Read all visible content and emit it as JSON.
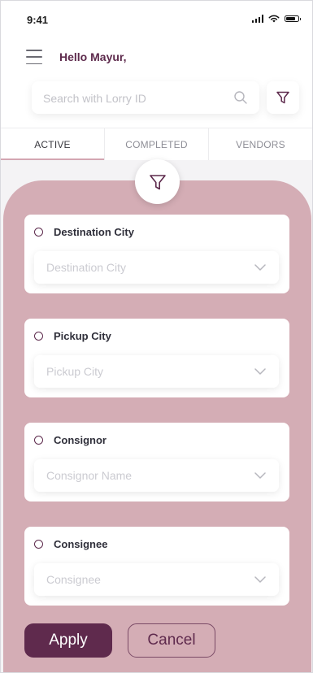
{
  "status_bar": {
    "time": "9:41"
  },
  "header": {
    "greeting": "Hello Mayur,"
  },
  "search": {
    "placeholder": "Search with Lorry ID",
    "value": ""
  },
  "tabs": [
    {
      "label": "ACTIVE",
      "active": true
    },
    {
      "label": "COMPLETED",
      "active": false
    },
    {
      "label": "VENDORS",
      "active": false
    }
  ],
  "filters": [
    {
      "title": "Destination City",
      "placeholder": "Destination City"
    },
    {
      "title": "Pickup City",
      "placeholder": "Pickup City"
    },
    {
      "title": "Consignor",
      "placeholder": "Consignor Name"
    },
    {
      "title": "Consignee",
      "placeholder": "Consignee"
    }
  ],
  "actions": {
    "apply_label": "Apply",
    "cancel_label": "Cancel"
  },
  "colors": {
    "brand": "#5f2a4d",
    "sheet": "#d4adb5",
    "tab_indicator": "#d3a6b2"
  },
  "icons": [
    "menu-icon",
    "search-icon",
    "filter-icon",
    "chevron-down-icon",
    "signal-icon",
    "wifi-icon",
    "battery-icon"
  ]
}
